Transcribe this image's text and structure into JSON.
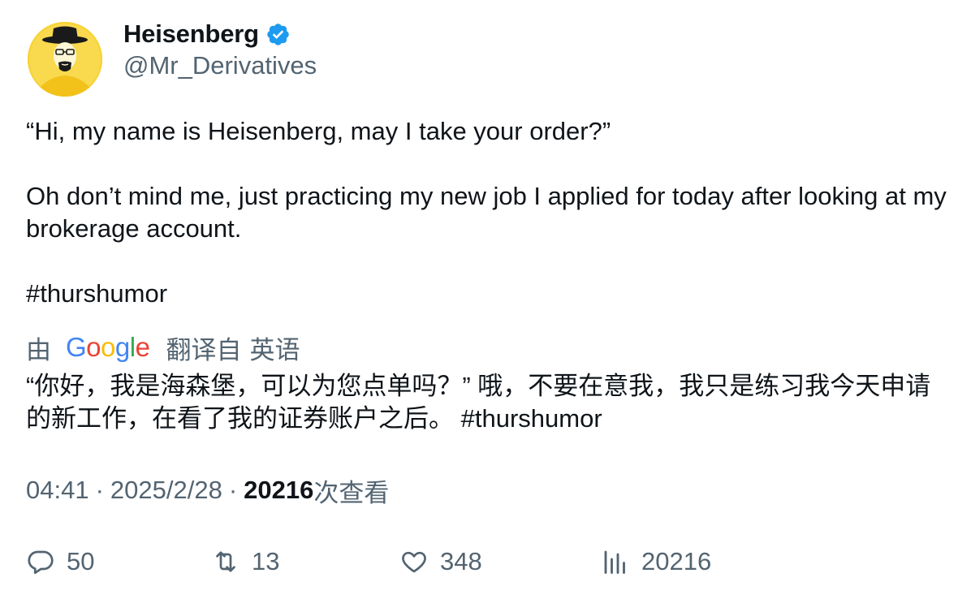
{
  "author": {
    "display_name": "Heisenberg",
    "handle": "@Mr_Derivatives",
    "verified": true,
    "verified_color": "#1d9bf0",
    "avatar_bg": "#f7d233"
  },
  "tweet": {
    "text": "“Hi, my name is Heisenberg, may I take your order?”\n\nOh don’t mind me, just practicing my new job I applied for today after looking at my brokerage account.\n\n#thurshumor"
  },
  "translation": {
    "by_label": "由",
    "provider": "Google",
    "translated_from": "翻译自",
    "language": "英语",
    "text": "“你好，我是海森堡，可以为您点单吗？” 哦，不要在意我，我只是练习我今天申请的新工作，在看了我的证券账户之后。 #thurshumor"
  },
  "meta": {
    "time": "04:41",
    "separator": "·",
    "date": "2025/2/28",
    "views_count": "20216",
    "views_label": "次查看"
  },
  "actions": {
    "replies": "50",
    "retweets": "13",
    "likes": "348",
    "views": "20216"
  },
  "colors": {
    "text_primary": "#0f1419",
    "text_secondary": "#536471"
  }
}
